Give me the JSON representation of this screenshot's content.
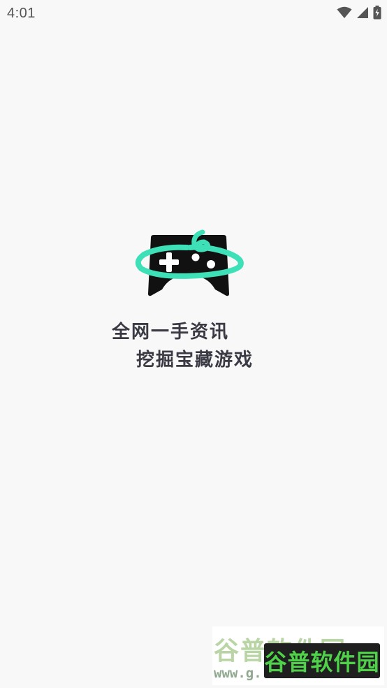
{
  "status_bar": {
    "time": "4:01",
    "icons": [
      "wifi-icon",
      "cellular-signal-icon",
      "battery-charging-icon"
    ]
  },
  "splash": {
    "logo_icon": "gamepad-logo-icon",
    "slogan_line1": "全网一手资讯",
    "slogan_line2": "挖掘宝藏游戏"
  },
  "watermark": {
    "name": "谷普软件园",
    "back_name": "谷普软件园",
    "url": "www.g...xiazai.com"
  },
  "colors": {
    "background": "#f8f8f8",
    "logo_body": "#111111",
    "logo_accent": "#3ee0b8",
    "slogan_text": "#3a3a44",
    "watermark_green": "#4fd14a"
  }
}
